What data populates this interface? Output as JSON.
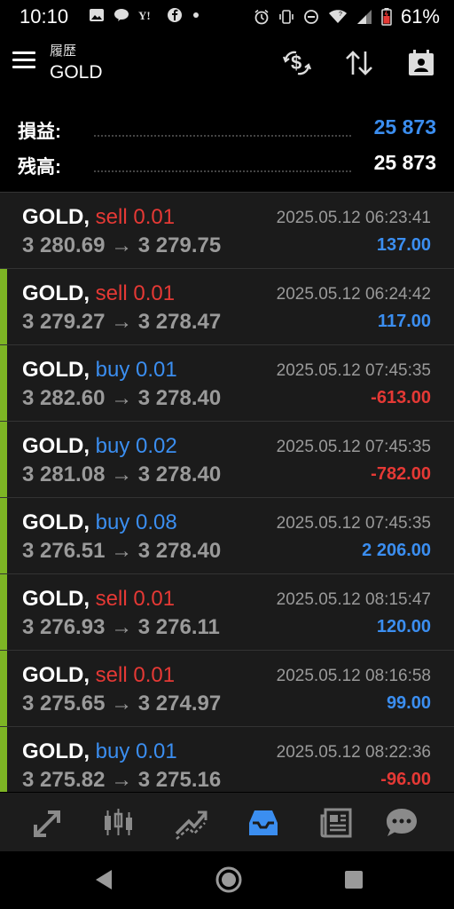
{
  "status_bar": {
    "time": "10:10",
    "battery_percent": "61%",
    "left_icons": [
      "gallery-icon",
      "line-icon",
      "yahoo-icon",
      "facebook-icon",
      "dot-icon"
    ],
    "right_icons": [
      "alarm-icon",
      "vibrate-icon",
      "dnd-icon",
      "wifi-icon",
      "signal-icon",
      "battery-icon"
    ]
  },
  "app_bar": {
    "subtitle": "履歴",
    "title": "GOLD"
  },
  "summary": {
    "profit_label": "損益:",
    "profit_value": "25 873",
    "balance_label": "残高:",
    "balance_value": "25 873"
  },
  "colors": {
    "sell": "#e53935",
    "buy": "#3b8ef0",
    "positive": "#3b8ef0",
    "negative": "#e53935",
    "accent_bar": "#7db524"
  },
  "trades": [
    {
      "symbol": "GOLD,",
      "type": "sell 0.01",
      "side": "sell",
      "open": "3 280.69",
      "arrow": "→",
      "close": "3 279.75",
      "time": "2025.05.12 06:23:41",
      "profit": "137.00",
      "profit_sign": "positive"
    },
    {
      "symbol": "GOLD,",
      "type": "sell 0.01",
      "side": "sell",
      "open": "3 279.27",
      "arrow": "→",
      "close": "3 278.47",
      "time": "2025.05.12 06:24:42",
      "profit": "117.00",
      "profit_sign": "positive"
    },
    {
      "symbol": "GOLD,",
      "type": "buy 0.01",
      "side": "buy",
      "open": "3 282.60",
      "arrow": "→",
      "close": "3 278.40",
      "time": "2025.05.12 07:45:35",
      "profit": "-613.00",
      "profit_sign": "negative"
    },
    {
      "symbol": "GOLD,",
      "type": "buy 0.02",
      "side": "buy",
      "open": "3 281.08",
      "arrow": "→",
      "close": "3 278.40",
      "time": "2025.05.12 07:45:35",
      "profit": "-782.00",
      "profit_sign": "negative"
    },
    {
      "symbol": "GOLD,",
      "type": "buy 0.08",
      "side": "buy",
      "open": "3 276.51",
      "arrow": "→",
      "close": "3 278.40",
      "time": "2025.05.12 07:45:35",
      "profit": "2 206.00",
      "profit_sign": "positive"
    },
    {
      "symbol": "GOLD,",
      "type": "sell 0.01",
      "side": "sell",
      "open": "3 276.93",
      "arrow": "→",
      "close": "3 276.11",
      "time": "2025.05.12 08:15:47",
      "profit": "120.00",
      "profit_sign": "positive"
    },
    {
      "symbol": "GOLD,",
      "type": "sell 0.01",
      "side": "sell",
      "open": "3 275.65",
      "arrow": "→",
      "close": "3 274.97",
      "time": "2025.05.12 08:16:58",
      "profit": "99.00",
      "profit_sign": "positive"
    },
    {
      "symbol": "GOLD,",
      "type": "buy 0.01",
      "side": "buy",
      "open": "3 275.82",
      "arrow": "→",
      "close": "3 275.16",
      "time": "2025.05.12 08:22:36",
      "profit": "-96.00",
      "profit_sign": "negative"
    }
  ],
  "bottom_nav": [
    {
      "name": "nav-quotes",
      "icon": "quotes-icon",
      "active": false
    },
    {
      "name": "nav-chart",
      "icon": "candlestick-icon",
      "active": false
    },
    {
      "name": "nav-trade",
      "icon": "trend-icon",
      "active": false
    },
    {
      "name": "nav-history",
      "icon": "inbox-icon",
      "active": true
    },
    {
      "name": "nav-news",
      "icon": "news-icon",
      "active": false
    },
    {
      "name": "nav-chat",
      "icon": "chat-icon",
      "active": false
    }
  ]
}
